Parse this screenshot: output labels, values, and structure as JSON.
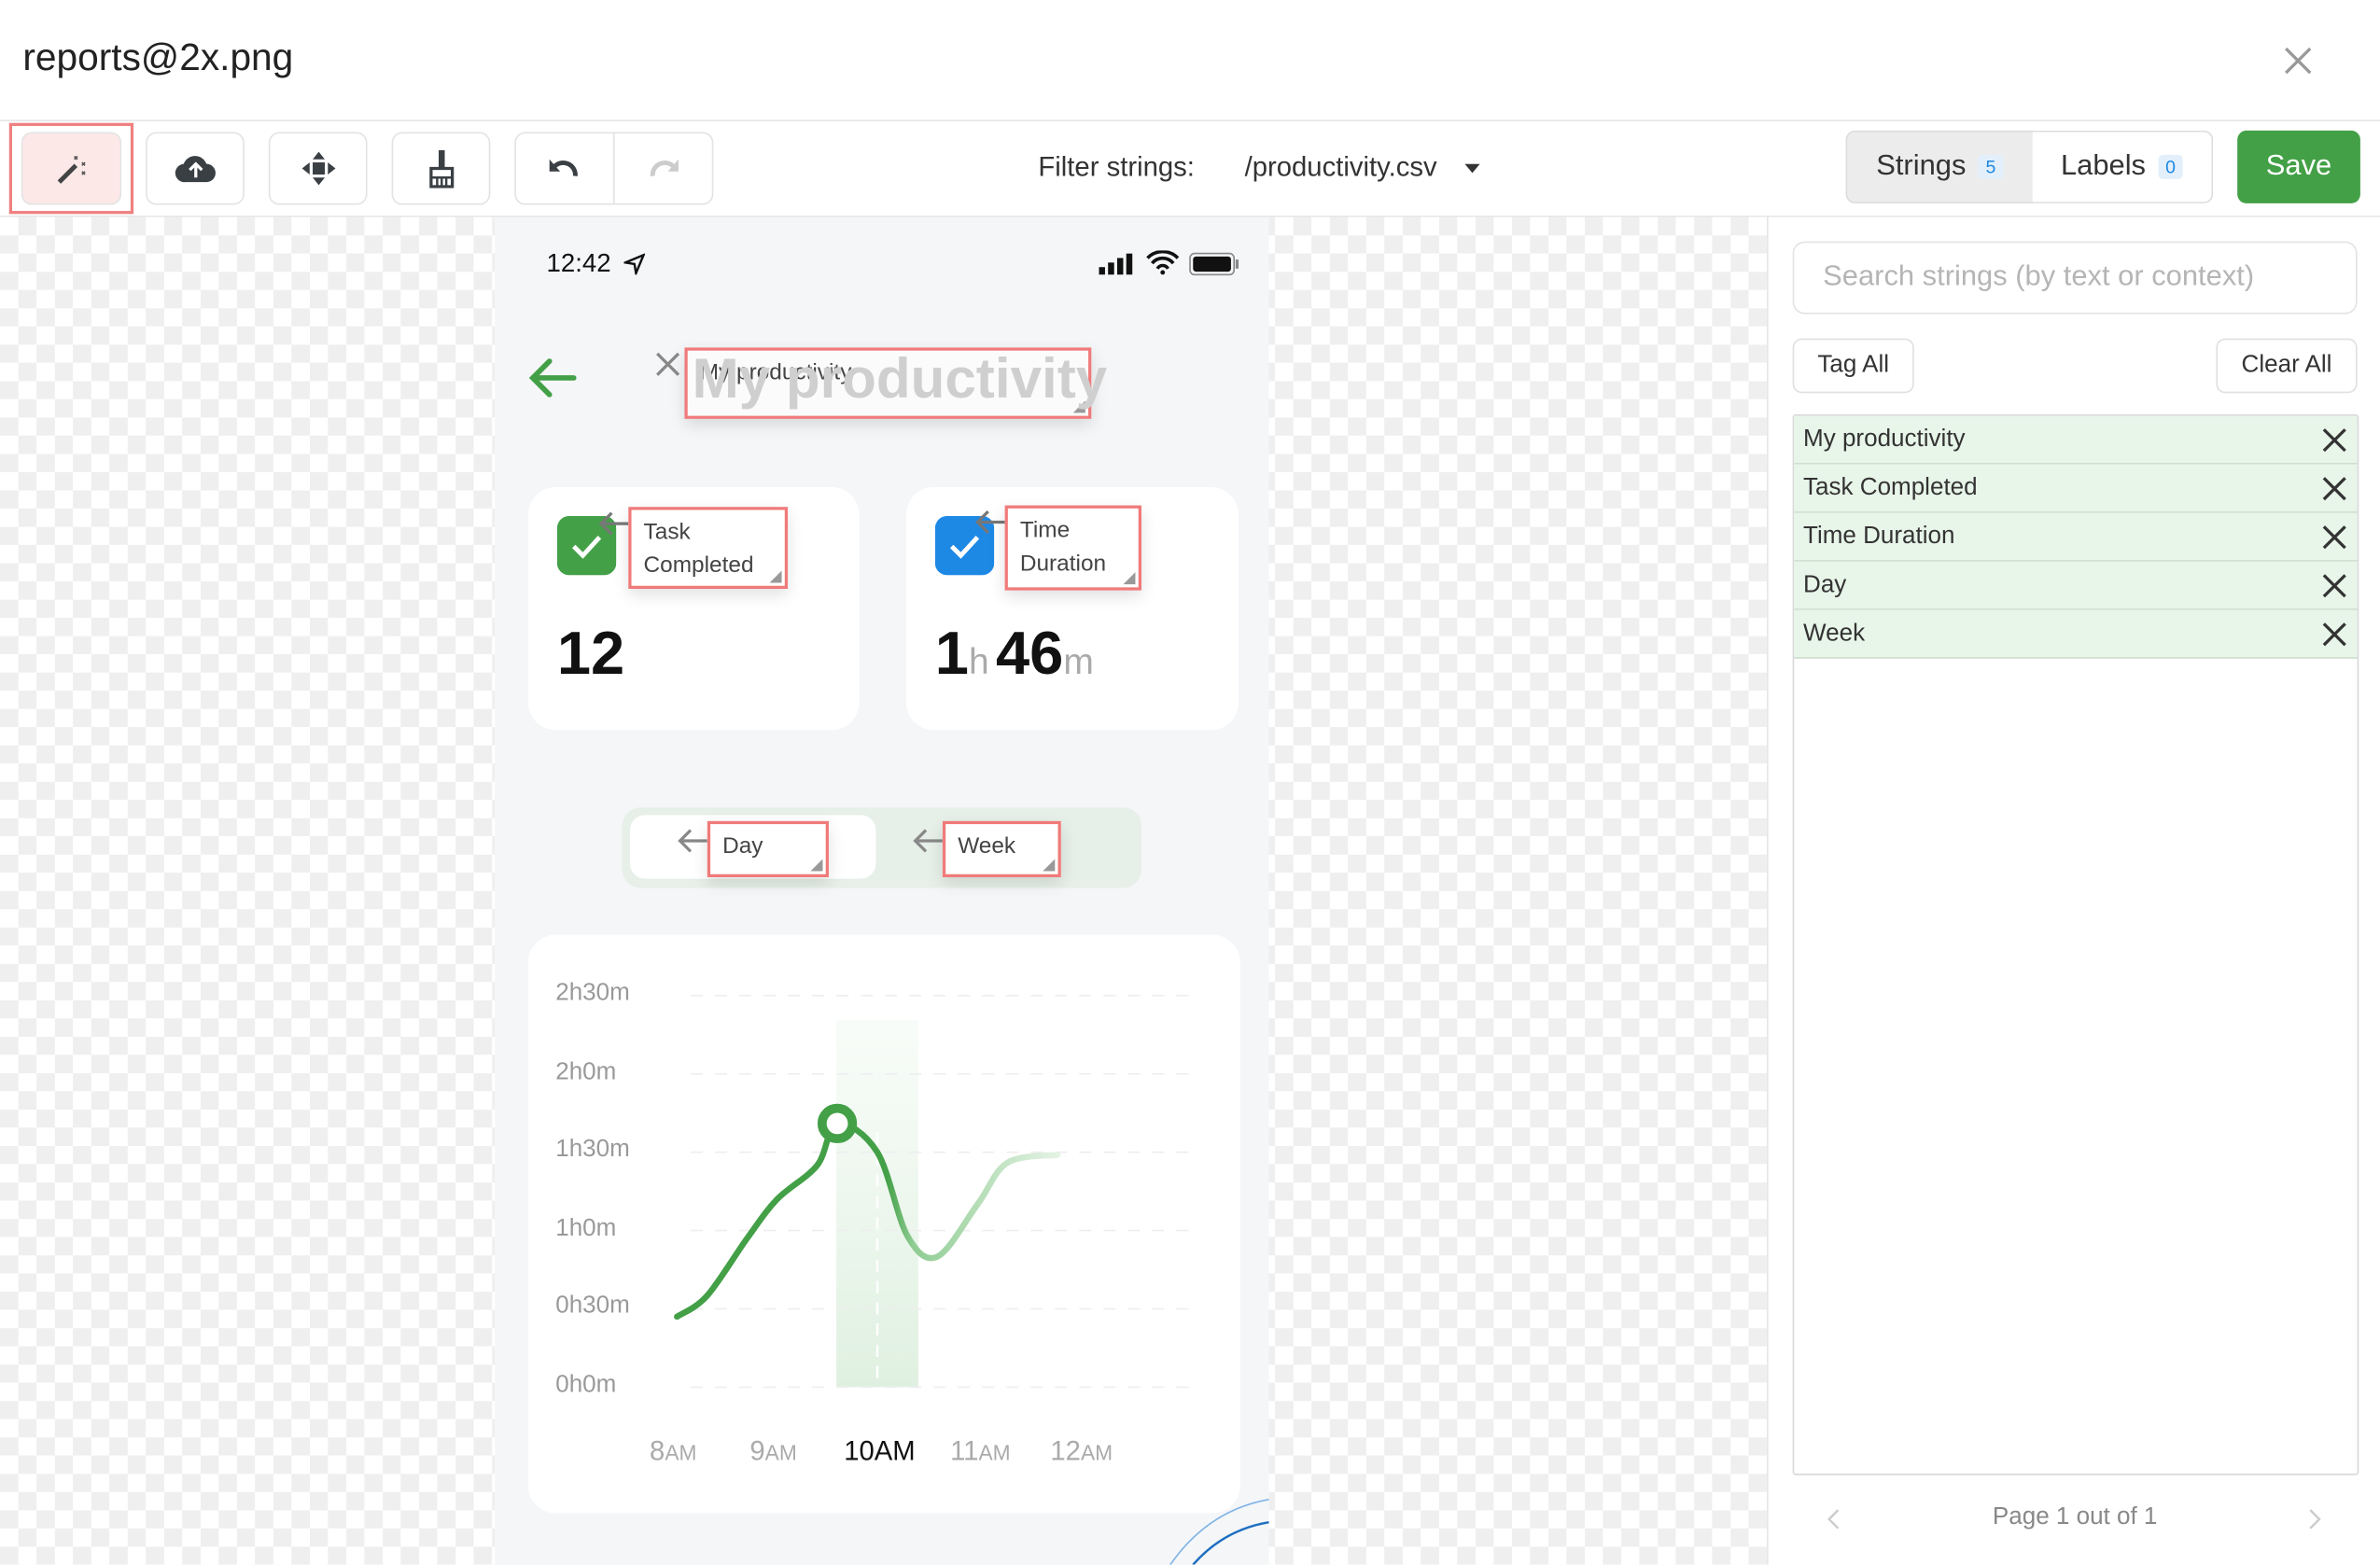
{
  "window": {
    "title": "reports@2x.png"
  },
  "toolbar": {
    "tools": [
      "magic-wand",
      "cloud-upload",
      "move",
      "broom",
      "undo",
      "redo"
    ],
    "filter_label": "Filter strings:",
    "filter_value": "/productivity.csv",
    "tabs": [
      {
        "label": "Strings",
        "count": "5",
        "active": true
      },
      {
        "label": "Labels",
        "count": "0",
        "active": false
      }
    ],
    "save_label": "Save"
  },
  "phone": {
    "status_time": "12:42",
    "title_ghost": "My productivity",
    "title_annotation": "My productivity",
    "cards": [
      {
        "annotation_line1": "Task",
        "annotation_line2": "Completed",
        "value": "12",
        "check_color": "#43a047"
      },
      {
        "annotation_line1": "Time",
        "annotation_line2": "Duration",
        "value_h": "1",
        "unit_h": "h",
        "value_m": "46",
        "unit_m": "m",
        "check_color": "#1e88e5"
      }
    ],
    "segments": [
      {
        "label": "Day",
        "active": true
      },
      {
        "label": "Week",
        "active": false
      }
    ],
    "chart": {
      "type": "line",
      "y_ticks": [
        "2h30m",
        "2h0m",
        "1h30m",
        "1h0m",
        "0h30m",
        "0h0m"
      ],
      "x_ticks": [
        {
          "num": "8",
          "unit": "AM"
        },
        {
          "num": "9",
          "unit": "AM"
        },
        {
          "num": "10",
          "unit": "AM",
          "active": true
        },
        {
          "num": "11",
          "unit": "AM"
        },
        {
          "num": "12",
          "unit": "AM"
        }
      ],
      "ylim_minutes": [
        0,
        150
      ],
      "points_minutes": [
        [
          8.0,
          27
        ],
        [
          8.3,
          35
        ],
        [
          8.7,
          57
        ],
        [
          9.0,
          72
        ],
        [
          9.4,
          85
        ],
        [
          9.6,
          101
        ],
        [
          10.0,
          90
        ],
        [
          10.3,
          58
        ],
        [
          10.6,
          50
        ],
        [
          11.0,
          70
        ],
        [
          11.3,
          86
        ],
        [
          11.8,
          89
        ]
      ],
      "highlight": "10AM",
      "line_color": "#43a047"
    }
  },
  "panel": {
    "search_placeholder": "Search strings (by text or context)",
    "tag_all": "Tag All",
    "clear_all": "Clear All",
    "strings": [
      "My productivity",
      "Task Completed",
      "Time Duration",
      "Day",
      "Week"
    ],
    "pagination": "Page 1 out of 1"
  }
}
